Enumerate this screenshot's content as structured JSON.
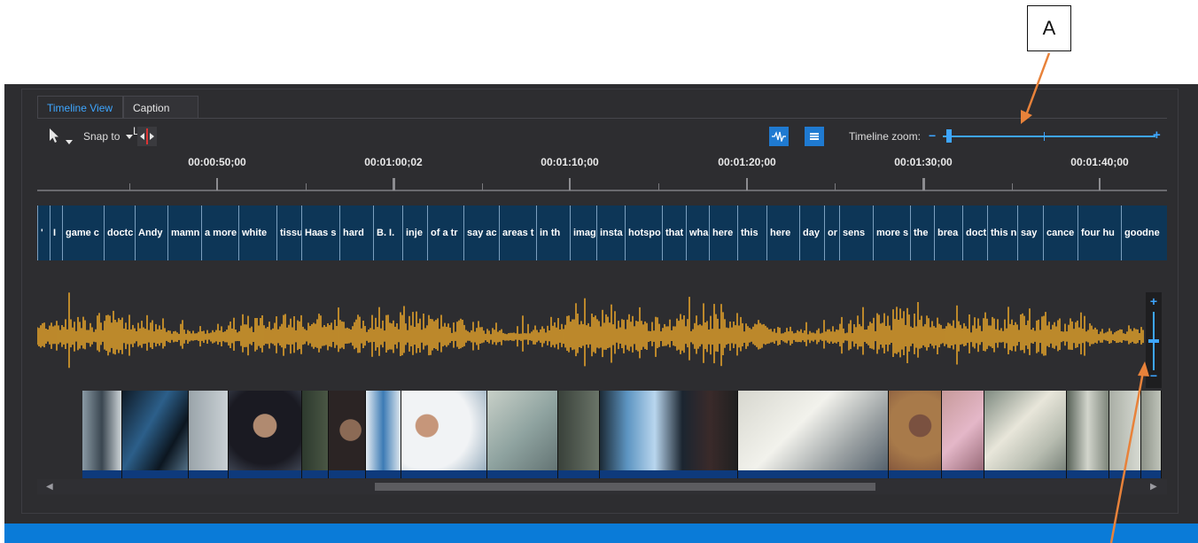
{
  "annotations": {
    "callout_a": "A"
  },
  "tabs": [
    {
      "label": "Timeline View",
      "active": true
    },
    {
      "label": "Caption List",
      "active": false
    }
  ],
  "toolbar": {
    "snap_label": "Snap to",
    "zoom_label": "Timeline zoom:",
    "zoom_minus": "−",
    "zoom_plus": "+",
    "icons": [
      "cursor-arrow-icon",
      "dropdown-caret-icon",
      "split-marker-icon",
      "waveform-toggle-icon",
      "caption-toggle-icon"
    ]
  },
  "ruler": {
    "time_labels": [
      "00:00:50;00",
      "00:01:00;02",
      "00:01:10;00",
      "00:01:20;00",
      "00:01:30;00",
      "00:01:40;00"
    ]
  },
  "captions": [
    "'",
    "I",
    "game c",
    "doctc",
    "Andy",
    "mamn",
    "a more",
    "white",
    "tissu",
    "Haas s",
    "hard",
    "B. I.",
    "inje",
    "of a tr",
    "say ac",
    "areas t",
    "in th",
    "imag",
    "insta",
    "hotspo",
    "that",
    "wha",
    "here",
    "this",
    "here",
    "day",
    "or",
    "sens",
    "more s",
    "the",
    "brea",
    "doct",
    "this n",
    "say",
    "cance",
    "four hu",
    "goodne"
  ],
  "vertical_zoom": {
    "plus": "+",
    "minus": "−"
  },
  "colors": {
    "accent_blue": "#1f7ad1",
    "waveform": "#e0a02a",
    "caption_bg": "#0d3657",
    "statusbar": "#0a7bd8",
    "callout_arrow": "#e8823a"
  }
}
